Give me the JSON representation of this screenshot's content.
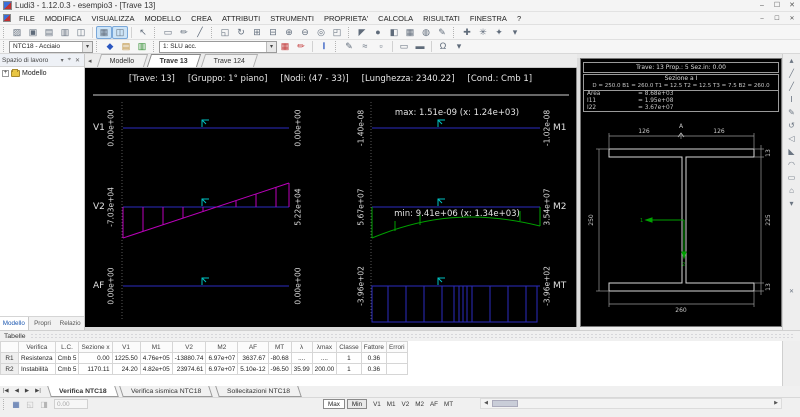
{
  "window": {
    "title": "Ludi3 - 1.12.0.3 - esempio3 - [Trave 13]"
  },
  "menu": {
    "items": [
      "FILE",
      "MODIFICA",
      "VISUALIZZA",
      "MODELLO",
      "CREA",
      "ATTRIBUTI",
      "STRUMENTI",
      "PROPRIETA'",
      "CALCOLA",
      "RISULTATI",
      "FINESTRA",
      "?"
    ]
  },
  "toolbar": {
    "norm_combo": "NTC18 - Acciaio",
    "case_combo": "1: SLU acc."
  },
  "doc_tabs": {
    "items": [
      "Modello",
      "Trave 13",
      "Trave 124"
    ]
  },
  "workspace": {
    "title": "Spazio di lavoro",
    "root": "Modello",
    "tabs": [
      "Modello",
      "Propri",
      "Relazio"
    ]
  },
  "beam_view": {
    "header": [
      "[Trave: 13]",
      "[Gruppo: 1° piano]",
      "[Nodi: (47 - 33)]",
      "[Lunghezza: 2340.22]",
      "[Cond.: Cmb 1]"
    ],
    "diagrams": {
      "v1": {
        "label": "V1",
        "left": "0.00e+00",
        "right": "0.00e+00"
      },
      "v2": {
        "label": "V2",
        "left": "-7.03e+04",
        "right": "5.22e+04"
      },
      "af": {
        "label": "AF",
        "left": "0.00e+00",
        "right": "0.00e+00"
      },
      "m1": {
        "label": "M1",
        "left": "-1.40e-08",
        "right": "-1.02e-08",
        "annotation": "max: 1.51e-09 (x: 1.24e+03)"
      },
      "m2": {
        "label": "M2",
        "left": "5.67e+07",
        "right": "3.54e+07",
        "annotation": "min: 9.41e+06 (x: 1.34e+03)"
      },
      "mt": {
        "label": "MT",
        "left": "-3.96e+02",
        "right": "-3.96e+02"
      }
    },
    "colors": {
      "axis": "#2b2bc0",
      "shear": "#bb00bb",
      "moment": "#00a000",
      "torsion": "#2b2bc0",
      "marker": "#00c2c2"
    }
  },
  "section_panel": {
    "header": "Trave: 13  Prop.: 5  Sez.in: 0.00",
    "shape": "Sezione a I",
    "dims": "D = 250.0  B1 = 260.0  T1 = 12.5  T2 = 12.5  T3 = 7.5  B2 = 260.0",
    "props": [
      {
        "name": "Area",
        "value": "= 8.68e+03"
      },
      {
        "name": "I11",
        "value": "= 1.95e+08"
      },
      {
        "name": "I22",
        "value": "= 3.67e+07"
      }
    ],
    "dim_labels": {
      "top_left": "126",
      "top_right": "126",
      "apex": "A",
      "left": "250",
      "right_top": "13",
      "right_mid": "225",
      "right_bottom": "13",
      "bottom": "260",
      "axis1": "1",
      "axis2": "2"
    }
  },
  "tables": {
    "panel_title": "Tabelle",
    "headers": [
      "",
      "Verifica",
      "L.C.",
      "Sezione x",
      "V1",
      "M1",
      "V2",
      "M2",
      "AF",
      "MT",
      "λ",
      "λmax",
      "Classe",
      "Fattore",
      "Errori"
    ],
    "rows": [
      {
        "id": "R1",
        "verifica": "Resistenza",
        "lc": "Cmb 5",
        "sezione": "0.00",
        "v1": "1225.50",
        "m1": "4.76e+05",
        "v2": "-13880.74",
        "m2": "6.97e+07",
        "af": "3637.67",
        "mt": "-80.68",
        "lambda": "....",
        "lambdamax": "....",
        "classe": "1",
        "fattore": "0.36",
        "errori": ""
      },
      {
        "id": "R2",
        "verifica": "Instabilità",
        "lc": "Cmb 5",
        "sezione": "1170.11",
        "v1": "24.20",
        "m1": "4.82e+05",
        "v2": "23974.61",
        "m2": "6.97e+07",
        "af": "5.10e-12",
        "mt": "-96.50",
        "lambda": "35.99",
        "lambdamax": "200.00",
        "classe": "1",
        "fattore": "0.36",
        "errori": ""
      }
    ],
    "tabs": [
      "Verifica NTC18",
      "Verifica sismica NTC18",
      "Sollecitazioni NTC18"
    ]
  },
  "bottom_bar": {
    "x_field": "0.00",
    "max_btn": "Max",
    "min_btn": "Min",
    "toggles": [
      "V1",
      "M1",
      "V2",
      "M2",
      "AF",
      "MT"
    ]
  },
  "icons": {
    "win": [
      "–",
      "☐",
      "✕"
    ],
    "ws": [
      "▾",
      "⌖",
      "✕"
    ],
    "strip": [
      "◂",
      "▸",
      "✕"
    ],
    "nav": [
      "|◀",
      "◀",
      "▶",
      "▶|"
    ],
    "tb1": [
      "▨",
      "▣",
      "▤",
      "▥",
      "◫",
      "▦",
      "◫",
      "↖",
      "▭",
      "✏",
      "╱",
      "◱",
      "↻",
      "⊞",
      "⊟",
      "⊕",
      "⊖",
      "◎",
      "◰",
      "◤",
      "●",
      "◧",
      "▦",
      "◍",
      "✎",
      "✚",
      "✳",
      "✦",
      "▾"
    ],
    "tb2": [
      "◆",
      "▤",
      "▥",
      "▦",
      "✏",
      "Ⅰ",
      "✎",
      "≈",
      "▫",
      "▭",
      "▬",
      "Ω",
      "▾"
    ],
    "right": [
      "▴",
      "╱",
      "╱",
      "Ⅰ",
      "✎",
      "↺",
      "◁",
      "◣",
      "◠",
      "▭",
      "⌂",
      "▾"
    ],
    "bbar": [
      "▦",
      "◱",
      "◨"
    ]
  }
}
